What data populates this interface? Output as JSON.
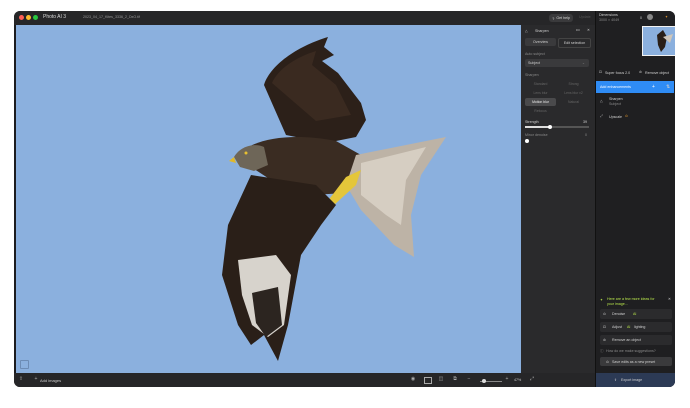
{
  "app": {
    "title": "Photo AI 3",
    "file_name": "2023_04_17_Kites_3336_2_DxO.tif"
  },
  "titlebar": {
    "get_help": "Get help",
    "update": "Update"
  },
  "adjust_panel": {
    "title": "Sharpen",
    "tabs": [
      "Overview",
      "Edit selection"
    ],
    "auto_label": "Auto subject",
    "subject_value": "Subject",
    "model_label": "Sharpen",
    "models": [
      "Standard",
      "Strong",
      "Lens blur",
      "Lens blur v2",
      "Motion blur",
      "Natural",
      "Refocus"
    ],
    "active_model": "Motion blur",
    "strength_label": "Strength",
    "strength_value": "39",
    "strength_fraction": 0.39,
    "noise_label": "Minor denoise",
    "noise_value": "0",
    "more_icon": "ellipsis-icon",
    "close_icon": "close-icon"
  },
  "sidebar": {
    "dimensions_label": "Dimensions",
    "dimensions_value": "3000 × 4049",
    "count": "0",
    "actions": [
      "Super focus 2.0",
      "Remove object"
    ],
    "add_enhancements": "Add enhancements",
    "sharpen_title": "Sharpen",
    "sharpen_sub": "Subject",
    "upscale": "Upscale",
    "suggest_title": "Here are a few more ideas for your image...",
    "suggestions": [
      {
        "icon": "denoise-icon",
        "label": "Denoise",
        "badge": "AI"
      },
      {
        "icon": "lighting-icon",
        "label": "Adjust",
        "badge": "AI",
        "suffix": "lighting"
      },
      {
        "icon": "remove-icon",
        "label": "Remove an object",
        "badge": "",
        "suffix": ""
      }
    ],
    "how_link": "How do we make suggestions?",
    "save_preset": "Save edits as a new preset",
    "export": "Export image"
  },
  "bottombar": {
    "add_images": "Add images",
    "zoom_value": "47%"
  },
  "colors": {
    "accent": "#2f8cf5",
    "canvas_sky": "#8bb0de",
    "suggest_green": "#b6e34b"
  }
}
